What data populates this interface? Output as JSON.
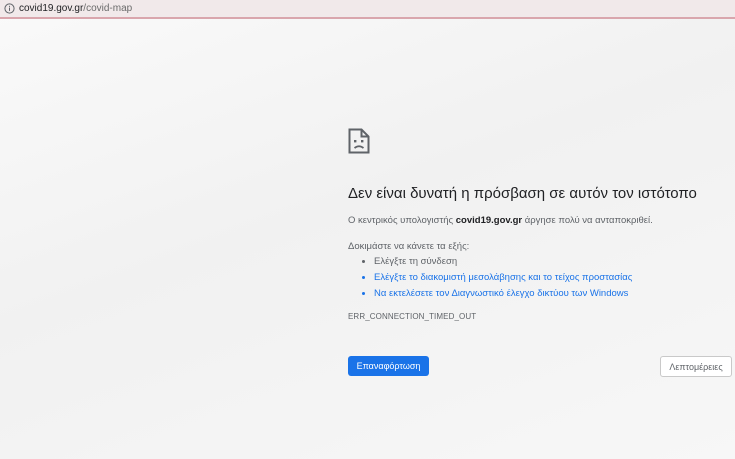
{
  "address_bar": {
    "host": "covid19.gov.gr",
    "path": "/covid-map",
    "icon": "info-icon"
  },
  "error": {
    "icon": "sad-page-icon",
    "title": "Δεν είναι δυνατή η πρόσβαση σε αυτόν τον ιστότοπο",
    "desc_prefix": "Ο κεντρικός υπολογιστής ",
    "desc_host": "covid19.gov.gr",
    "desc_suffix": " άργησε πολύ να ανταποκριθεί.",
    "try_label": "Δοκιμάστε να κάνετε τα εξής:",
    "suggestions": [
      "Ελέγξτε τη σύνδεση",
      "Ελέγξτε το διακομιστή μεσολάβησης και το τείχος προστασίας",
      "Να εκτελέσετε τον Διαγνωστικό έλεγχο δικτύου των Windows"
    ],
    "code": "ERR_CONNECTION_TIMED_OUT"
  },
  "buttons": {
    "reload": "Επαναφόρτωση",
    "details": "Λεπτομέρειες"
  },
  "colors": {
    "accent": "#1a73e8",
    "text": "#202124",
    "secondary_text": "#5f6368",
    "address_bar_bg": "#f1e9ea"
  }
}
